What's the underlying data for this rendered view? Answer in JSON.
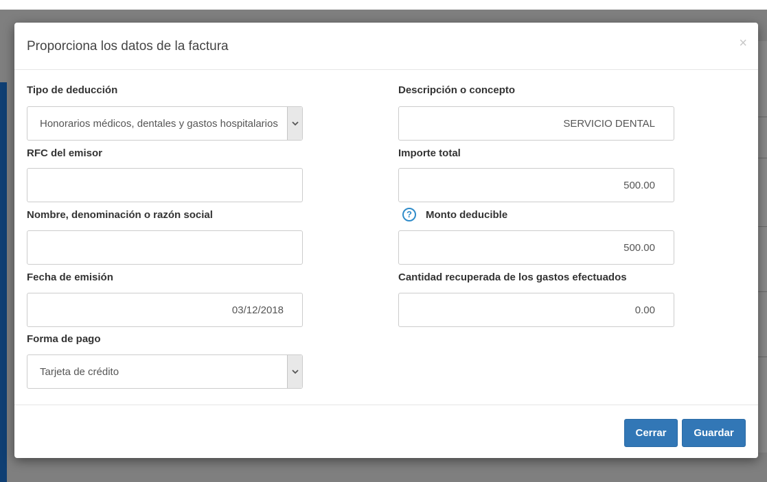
{
  "modal": {
    "title": "Proporciona los datos de la factura",
    "close_symbol": "×"
  },
  "form": {
    "tipo_deduccion": {
      "label": "Tipo de deducción",
      "value": "Honorarios médicos, dentales y gastos hospitalarios"
    },
    "descripcion": {
      "label": "Descripción o concepto",
      "value": "SERVICIO DENTAL"
    },
    "rfc_emisor": {
      "label": "RFC del emisor",
      "value": ""
    },
    "importe_total": {
      "label": "Importe total",
      "value": "500.00"
    },
    "nombre": {
      "label": "Nombre, denominación o razón social",
      "value": ""
    },
    "monto_deducible": {
      "label": "Monto deducible",
      "value": "500.00",
      "help_icon": "question-circle-icon"
    },
    "fecha_emision": {
      "label": "Fecha de emisión",
      "value": "03/12/2018"
    },
    "cantidad_recuperada": {
      "label": "Cantidad recuperada de los gastos efectuados",
      "value": "0.00"
    },
    "forma_pago": {
      "label": "Forma de pago",
      "value": "Tarjeta de crédito"
    }
  },
  "footer": {
    "cerrar_label": "Cerrar",
    "guardar_label": "Guardar"
  },
  "colors": {
    "primary_button": "#3277b6",
    "help_icon": "#2e8bc9",
    "overlay": "#7f7f7f",
    "side_bar": "#0f3f73"
  }
}
